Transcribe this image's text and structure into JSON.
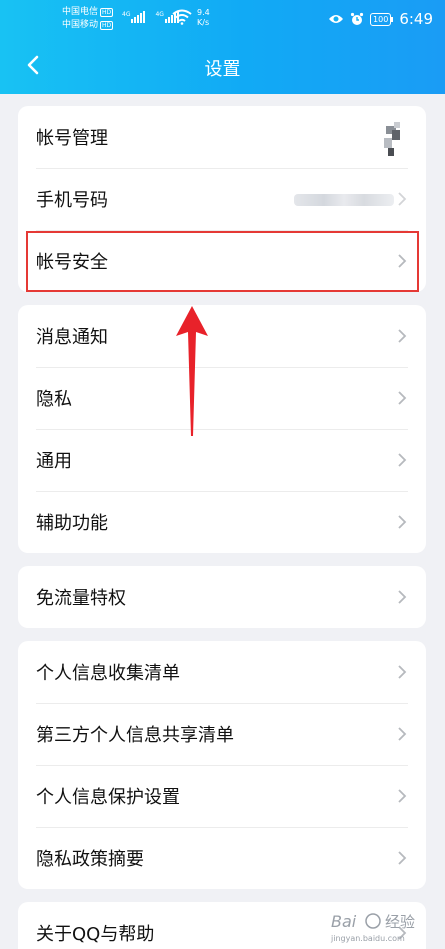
{
  "status_bar": {
    "carrier1": "中国电信",
    "carrier2": "中国移动",
    "hd1": "HD",
    "hd2": "HD",
    "net1": "4G",
    "net2": "4G",
    "speed_value": "9.4",
    "speed_unit": "K/s",
    "battery": "100",
    "time": "6:49"
  },
  "header": {
    "title": "设置"
  },
  "card1": {
    "items": [
      {
        "label": "帐号管理"
      },
      {
        "label": "手机号码"
      },
      {
        "label": "帐号安全"
      }
    ]
  },
  "card2": {
    "items": [
      {
        "label": "消息通知"
      },
      {
        "label": "隐私"
      },
      {
        "label": "通用"
      },
      {
        "label": "辅助功能"
      }
    ]
  },
  "card3": {
    "items": [
      {
        "label": "免流量特权"
      }
    ]
  },
  "card4": {
    "items": [
      {
        "label": "个人信息收集清单"
      },
      {
        "label": "第三方个人信息共享清单"
      },
      {
        "label": "个人信息保护设置"
      },
      {
        "label": "隐私政策摘要"
      }
    ]
  },
  "card5": {
    "items": [
      {
        "label": "关于QQ与帮助"
      }
    ]
  },
  "watermark": {
    "brand": "Bai",
    "sub": "经验",
    "url": "jingyan.baidu.com"
  },
  "colors": {
    "header_start": "#18c2f3",
    "header_end": "#1a9cf5",
    "highlight": "#e53935",
    "background": "#f0f1f5"
  },
  "icons": {
    "back": "chevron-left-icon",
    "row_arrow": "chevron-right-icon"
  }
}
